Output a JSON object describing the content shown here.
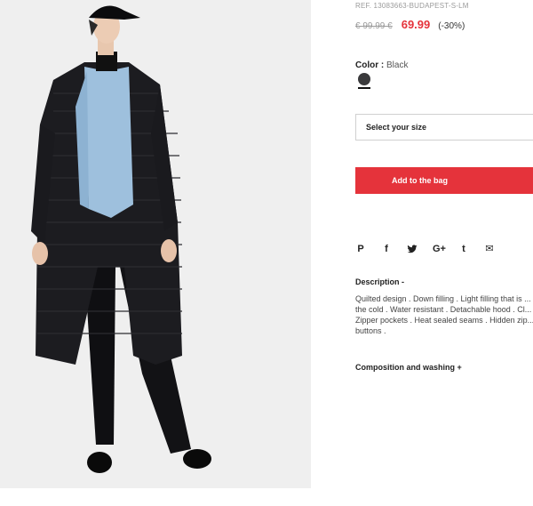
{
  "product": {
    "ref": "REF. 13083663-BUDAPEST-S-LM",
    "old_price": "€ 99.99 €",
    "new_price": "69.99",
    "discount": "(-30%)",
    "color_label": "Color :",
    "color_value": "Black",
    "color_swatch": "#3a3a3c",
    "size_placeholder": "Select your size",
    "add_to_bag": "Add to the bag"
  },
  "social": [
    {
      "name": "pinterest-icon",
      "glyph": "P"
    },
    {
      "name": "facebook-icon",
      "glyph": "f"
    },
    {
      "name": "twitter-icon",
      "glyph": "t"
    },
    {
      "name": "google-plus-icon",
      "glyph": "G+"
    },
    {
      "name": "tumblr-icon",
      "glyph": "t"
    },
    {
      "name": "email-icon",
      "glyph": "✉"
    }
  ],
  "description": {
    "title": "Description -",
    "text": "Quilted design . Down filling . Light filling that is ... the cold . Water resistant . Detachable hood . Cl... Zipper pockets . Heat sealed seams . Hidden zip... buttons ."
  },
  "composition": {
    "title": "Composition and washing +"
  },
  "colors": {
    "accent": "#e5333b"
  }
}
